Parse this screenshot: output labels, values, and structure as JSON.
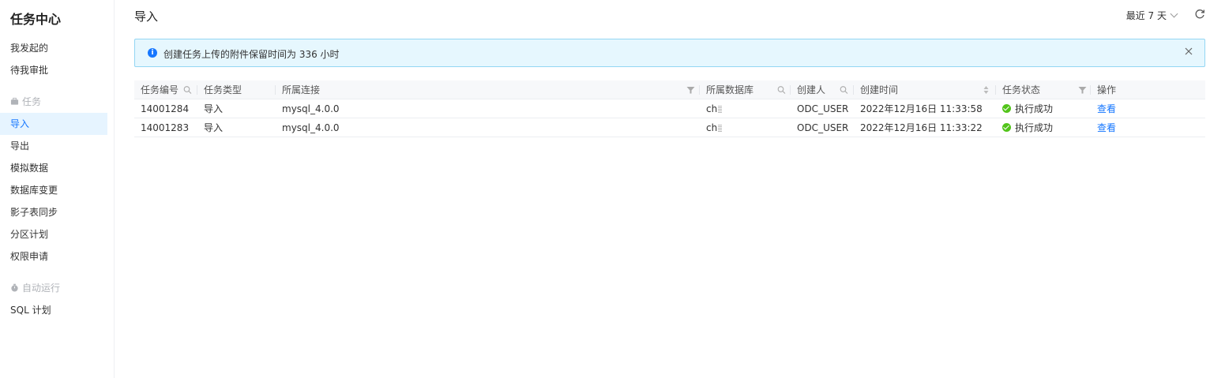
{
  "sidebar": {
    "title": "任务中心",
    "top_items": [
      {
        "label": "我发起的"
      },
      {
        "label": "待我审批"
      }
    ],
    "group_task": "任务",
    "task_items": [
      {
        "label": "导入",
        "active": true
      },
      {
        "label": "导出"
      },
      {
        "label": "模拟数据"
      },
      {
        "label": "数据库变更"
      },
      {
        "label": "影子表同步"
      },
      {
        "label": "分区计划"
      },
      {
        "label": "权限申请"
      }
    ],
    "group_auto": "自动运行",
    "auto_items": [
      {
        "label": "SQL 计划"
      }
    ]
  },
  "header": {
    "title": "导入",
    "range_label": "最近 7 天"
  },
  "alert": {
    "message": "创建任务上传的附件保留时间为 336 小时"
  },
  "table": {
    "columns": {
      "id": "任务编号",
      "type": "任务类型",
      "conn": "所属连接",
      "db": "所属数据库",
      "user": "创建人",
      "time": "创建时间",
      "status": "任务状态",
      "op": "操作"
    },
    "rows": [
      {
        "id": "14001284",
        "type": "导入",
        "conn": "mysql_4.0.0",
        "db": "ch",
        "user": "ODC_USER",
        "time": "2022年12月16日 11:33:58",
        "status": "执行成功",
        "op": "查看"
      },
      {
        "id": "14001283",
        "type": "导入",
        "conn": "mysql_4.0.0",
        "db": "ch",
        "user": "ODC_USER",
        "time": "2022年12月16日 11:33:22",
        "status": "执行成功",
        "op": "查看"
      }
    ]
  },
  "colors": {
    "accent": "#1677ff",
    "success": "#52c41a",
    "alert_bg": "#e6f7fe",
    "alert_border": "#93d6f3"
  }
}
